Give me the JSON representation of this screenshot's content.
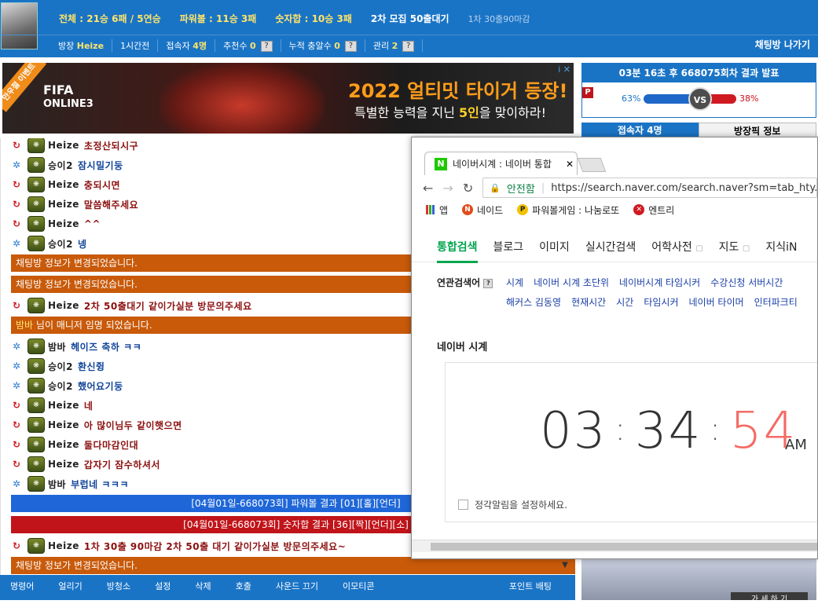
{
  "header": {
    "stats": {
      "total": "전체 : 21승 6패 / 5연승",
      "powerball": "파워볼 : 11승 3패",
      "number": "숫자합 : 10승 3패",
      "recruit": "2차 모집 50출대기",
      "deadline": "1차 30출90마감"
    },
    "room": {
      "host_label": "방장",
      "host_name": "Heize",
      "time": "1시간전",
      "users_label": "접속자",
      "users": "4명",
      "recommend_label": "추천수",
      "recommend": "0",
      "cumulative_label": "누적 충알수",
      "cumulative": "0",
      "manage_label": "관리",
      "manage": "2",
      "help": "?",
      "exit": "채팅방 나가기"
    }
  },
  "ad": {
    "ribbon": "만우절 이벤트",
    "brand1": "FIFA",
    "brand2": "ONLINE3",
    "title": "2022 얼티밋 타이거 등장!",
    "sub_pre": "특별한 능력을 지닌 ",
    "sub_hl": "5인",
    "sub_post": "을 맞이하라!",
    "badge": "i ✕"
  },
  "result": {
    "head": "03분 16초 후 668075회차 결과 발표",
    "flag": "P",
    "left_pct": "63%",
    "right_pct": "38%",
    "vs": "VS"
  },
  "side_tabs": {
    "users": "접속자 4명",
    "info": "방장픽 정보"
  },
  "chat": [
    {
      "type": "msg",
      "icon": "r",
      "nick": "Heize",
      "text": "초정산되시구",
      "color": "red"
    },
    {
      "type": "msg",
      "icon": "b",
      "nick": "승이2",
      "text": "잠시밀기둥",
      "color": "blue"
    },
    {
      "type": "msg",
      "icon": "r",
      "nick": "Heize",
      "text": "충되시면",
      "color": "red"
    },
    {
      "type": "msg",
      "icon": "r",
      "nick": "Heize",
      "text": "말씀해주세요",
      "color": "red"
    },
    {
      "type": "msg",
      "icon": "r",
      "nick": "Heize",
      "text": "^^",
      "color": "red"
    },
    {
      "type": "msg",
      "icon": "b",
      "nick": "승이2",
      "text": "넹",
      "color": "blue"
    },
    {
      "type": "bar",
      "style": "orange",
      "text": "채팅방 정보가 변경되었습니다."
    },
    {
      "type": "bar",
      "style": "orange",
      "text": "채팅방 정보가 변경되었습니다."
    },
    {
      "type": "msg",
      "icon": "r",
      "nick": "Heize",
      "text": "2차 50출대기 같이가실분 방문의주세요",
      "color": "red"
    },
    {
      "type": "bar",
      "style": "orange",
      "hl": "밤바",
      "text": " 님이 매니저 임명 되었습니다."
    },
    {
      "type": "msg",
      "icon": "b",
      "nick": "밤바",
      "text": "헤이즈 축하 ㅋㅋ",
      "color": "blue"
    },
    {
      "type": "msg",
      "icon": "b",
      "nick": "승이2",
      "text": "환신쥥",
      "color": "blue"
    },
    {
      "type": "msg",
      "icon": "b",
      "nick": "승이2",
      "text": "했어요기둥",
      "color": "blue"
    },
    {
      "type": "msg",
      "icon": "r",
      "nick": "Heize",
      "text": "네",
      "color": "red"
    },
    {
      "type": "msg",
      "icon": "r",
      "nick": "Heize",
      "text": "아 많이님두 같이햇으면",
      "color": "red"
    },
    {
      "type": "msg",
      "icon": "r",
      "nick": "Heize",
      "text": "둘다마감인대",
      "color": "red"
    },
    {
      "type": "msg",
      "icon": "r",
      "nick": "Heize",
      "text": "갑자기 잠수하셔서",
      "color": "red"
    },
    {
      "type": "msg",
      "icon": "b",
      "nick": "밤바",
      "text": "부럽네 ㅋㅋㅋ",
      "color": "blue"
    },
    {
      "type": "bar",
      "style": "bluebar",
      "text": "[04월01일-668073회] 파워볼 결과 [01][홀][언더]"
    },
    {
      "type": "bar",
      "style": "redbar",
      "text": "[04월01일-668073회] 숫자합 결과 [36][짝][언더][소]"
    },
    {
      "type": "msg",
      "icon": "r",
      "nick": "Heize",
      "text": "1차 30출 90마감 2차 50출 대기 같이가실분 방문의주세요~",
      "color": "red"
    },
    {
      "type": "bar",
      "style": "orange",
      "text": "채팅방 정보가 변경되었습니다."
    }
  ],
  "bottom": {
    "items": [
      "명령어",
      "얼리기",
      "방청소",
      "설정",
      "삭제",
      "호출",
      "사운드 끄기",
      "이모티콘"
    ],
    "point": "포인트 배팅"
  },
  "right_promo": {
    "join": "가 세 하 기"
  },
  "browser": {
    "tab_title": "네이버시계 : 네이버 통합",
    "tab_close": "✕",
    "secure": "안전함",
    "url": "https://search.naver.com/search.naver?sm=tab_hty.top",
    "bookmarks": [
      "앱",
      "네이드",
      "파워볼게임 : 나눔로또",
      "엔트리"
    ],
    "nav": [
      "통합검색",
      "블로그",
      "이미지",
      "실시간검색",
      "어학사전",
      "지도",
      "지식iN"
    ],
    "related_label": "연관검색어",
    "related_row1": [
      "시계",
      "네이버 시계 초단위",
      "네이버시계 타임시커",
      "수강신청 서버시간"
    ],
    "related_row2": [
      "해커스 김동영",
      "현재시간",
      "시간",
      "타임시커",
      "네이버 타이머",
      "인터파크티"
    ],
    "section": "네이버 시계",
    "clock": {
      "h": "03",
      "m": "34",
      "s": "54",
      "ampm": "AM"
    },
    "alarm": "정각알림을 설정하세요."
  }
}
